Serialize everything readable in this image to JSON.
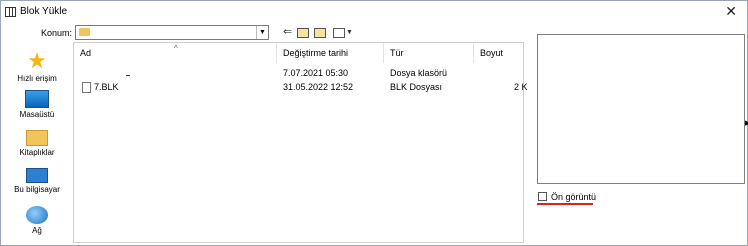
{
  "window": {
    "title": "Blok Yükle"
  },
  "location": {
    "label": "Konum:",
    "value": ""
  },
  "places": [
    {
      "label": "Hızlı erişim"
    },
    {
      "label": "Masaüstü"
    },
    {
      "label": "Kitaplıklar"
    },
    {
      "label": "Bu bilgisayar"
    },
    {
      "label": "Ağ"
    }
  ],
  "columns": {
    "name": "Ad",
    "date": "Değiştirme tarihi",
    "type": "Tür",
    "size": "Boyut"
  },
  "rows": [
    {
      "name": "",
      "date": "7.07.2021 05:30",
      "type": "Dosya klasörü",
      "size": ""
    },
    {
      "name": "7.BLK",
      "date": "31.05.2022 12:52",
      "type": "BLK Dosyası",
      "size": "2 K"
    }
  ],
  "preview": {
    "checkbox_label": "Ön görüntü",
    "checked": false
  },
  "colors": {
    "accent_underline": "#e01f1f",
    "folder": "#f2c45c"
  }
}
